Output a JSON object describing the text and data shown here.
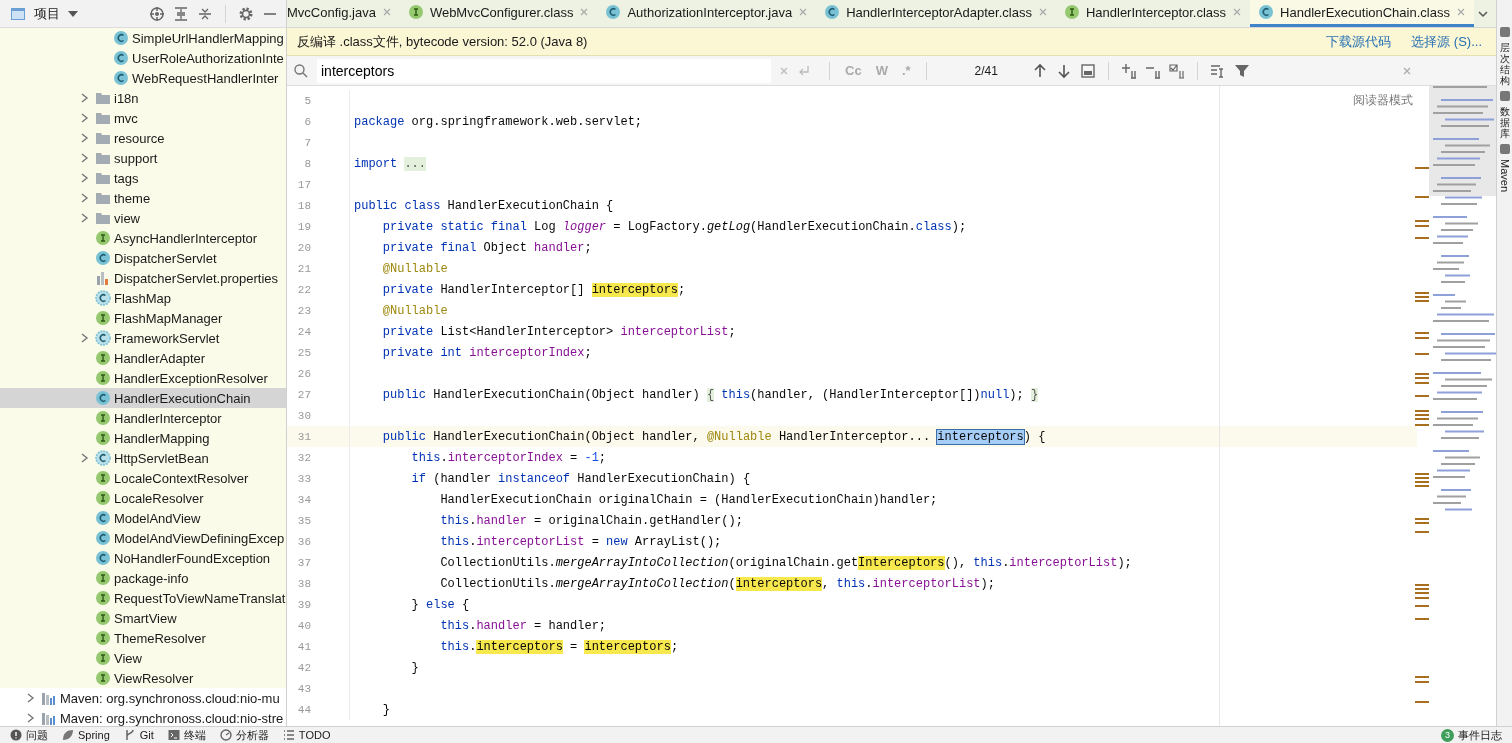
{
  "project_panel": {
    "title": "项目"
  },
  "tree": [
    {
      "children": [
        {
          "children": [
            {
              "children": [
                {
                  "children": [
                    {
                      "label": "SimpleUrlHandlerMapping",
                      "kind": "class",
                      "selected": false
                    },
                    {
                      "label": "UserRoleAuthorizationInte",
                      "kind": "class",
                      "selected": false
                    },
                    {
                      "label": "WebRequestHandlerInter",
                      "kind": "class",
                      "selected": false
                    }
                  ]
                },
                {
                  "label": "i18n",
                  "kind": "folder",
                  "expanded": false,
                  "selected": false
                },
                {
                  "label": "mvc",
                  "kind": "folder",
                  "expanded": false,
                  "selected": false
                },
                {
                  "label": "resource",
                  "kind": "folder",
                  "expanded": false,
                  "selected": false
                },
                {
                  "label": "support",
                  "kind": "folder",
                  "expanded": false,
                  "selected": false
                },
                {
                  "label": "tags",
                  "kind": "folder",
                  "expanded": false,
                  "selected": false
                },
                {
                  "label": "theme",
                  "kind": "folder",
                  "expanded": false,
                  "selected": false
                },
                {
                  "label": "view",
                  "kind": "folder",
                  "expanded": false,
                  "selected": false
                },
                {
                  "label": "AsyncHandlerInterceptor",
                  "kind": "interface",
                  "selected": false
                },
                {
                  "label": "DispatcherServlet",
                  "kind": "class",
                  "selected": false
                },
                {
                  "label": "DispatcherServlet.properties",
                  "kind": "properties",
                  "selected": false
                },
                {
                  "label": "FlashMap",
                  "kind": "abstract",
                  "selected": false
                },
                {
                  "label": "FlashMapManager",
                  "kind": "interface",
                  "selected": false
                },
                {
                  "label": "FrameworkServlet",
                  "kind": "abstract",
                  "expanded": false,
                  "selected": false
                },
                {
                  "label": "HandlerAdapter",
                  "kind": "interface",
                  "selected": false
                },
                {
                  "label": "HandlerExceptionResolver",
                  "kind": "interface",
                  "selected": false
                },
                {
                  "label": "HandlerExecutionChain",
                  "kind": "class",
                  "selected": true
                },
                {
                  "label": "HandlerInterceptor",
                  "kind": "interface",
                  "selected": false
                },
                {
                  "label": "HandlerMapping",
                  "kind": "interface",
                  "selected": false
                },
                {
                  "label": "HttpServletBean",
                  "kind": "abstract",
                  "expanded": false,
                  "selected": false
                },
                {
                  "label": "LocaleContextResolver",
                  "kind": "interface",
                  "selected": false
                },
                {
                  "label": "LocaleResolver",
                  "kind": "interface",
                  "selected": false
                },
                {
                  "label": "ModelAndView",
                  "kind": "class",
                  "selected": false
                },
                {
                  "label": "ModelAndViewDefiningExcep",
                  "kind": "class",
                  "selected": false
                },
                {
                  "label": "NoHandlerFoundException",
                  "kind": "class",
                  "selected": false
                },
                {
                  "label": "package-info",
                  "kind": "interface",
                  "selected": false
                },
                {
                  "label": "RequestToViewNameTranslat",
                  "kind": "interface",
                  "selected": false
                },
                {
                  "label": "SmartView",
                  "kind": "interface",
                  "selected": false
                },
                {
                  "label": "ThemeResolver",
                  "kind": "interface",
                  "selected": false
                },
                {
                  "label": "View",
                  "kind": "interface",
                  "selected": false
                },
                {
                  "label": "ViewResolver",
                  "kind": "interface",
                  "selected": false
                }
              ]
            }
          ]
        }
      ]
    },
    {
      "label": "Maven: org.synchronoss.cloud:nio-mu",
      "kind": "library",
      "expanded": false,
      "selected": false
    },
    {
      "label": "Maven: org.synchronoss.cloud:nio-stre",
      "kind": "library",
      "expanded": false,
      "selected": false
    }
  ],
  "tabs": [
    {
      "label": "MvcConfig.java",
      "selected": false
    },
    {
      "label": "WebMvcConfigurer.class",
      "kind": "interface",
      "selected": false
    },
    {
      "label": "AuthorizationInterceptor.java",
      "kind": "class",
      "selected": false
    },
    {
      "label": "HandlerInterceptorAdapter.class",
      "kind": "class",
      "selected": false
    },
    {
      "label": "HandlerInterceptor.class",
      "kind": "interface",
      "selected": false
    },
    {
      "label": "HandlerExecutionChain.class",
      "kind": "class",
      "selected": true
    }
  ],
  "info_bar": {
    "message": "反编译 .class文件, bytecode version: 52.0 (Java 8)",
    "links": [
      "下载源代码",
      "选择源 (S)..."
    ]
  },
  "find_bar": {
    "value": "interceptors",
    "options": [
      "Cc",
      "W",
      ".*"
    ],
    "match_count": "2/41"
  },
  "reader_mode": "阅读器模式",
  "code": [
    {
      "no": "5",
      "current": false
    },
    {
      "no": "6",
      "current": false,
      "segments": [
        {
          "kind": "k",
          "text": "package"
        },
        {
          "kind": "t",
          "text": " org.springframework.web.servlet;"
        }
      ]
    },
    {
      "no": "7",
      "current": false
    },
    {
      "no": "8",
      "current": false,
      "segments": [
        {
          "kind": "k",
          "text": "import "
        },
        {
          "kind": "fold",
          "text": "..."
        }
      ]
    },
    {
      "no": "17",
      "current": false
    },
    {
      "no": "18",
      "current": false,
      "segments": [
        {
          "kind": "k",
          "text": "public class"
        },
        {
          "kind": "t",
          "text": " HandlerExecutionChain {"
        }
      ]
    },
    {
      "no": "19",
      "current": false,
      "segments": [
        {
          "kind": "k",
          "text": "    private static final"
        },
        {
          "kind": "t",
          "text": " Log "
        },
        {
          "kind": "fi",
          "text": "logger"
        },
        {
          "kind": "t",
          "text": " = LogFactory."
        },
        {
          "kind": "i",
          "text": "getLog"
        },
        {
          "kind": "t",
          "text": "(HandlerExecutionChain."
        },
        {
          "kind": "k",
          "text": "class"
        },
        {
          "kind": "t",
          "text": ");"
        }
      ]
    },
    {
      "no": "20",
      "current": false,
      "segments": [
        {
          "kind": "k",
          "text": "    private final"
        },
        {
          "kind": "t",
          "text": " Object "
        },
        {
          "kind": "f",
          "text": "handler"
        },
        {
          "kind": "t",
          "text": ";"
        }
      ]
    },
    {
      "no": "21",
      "current": false,
      "segments": [
        {
          "kind": "a",
          "text": "    @Nullable"
        }
      ]
    },
    {
      "no": "22",
      "current": false,
      "segments": [
        {
          "kind": "k",
          "text": "    private"
        },
        {
          "kind": "t",
          "text": " HandlerInterceptor[] "
        },
        {
          "kind": "m",
          "text": "interceptors"
        },
        {
          "kind": "t",
          "text": ";"
        }
      ]
    },
    {
      "no": "23",
      "current": false,
      "segments": [
        {
          "kind": "a",
          "text": "    @Nullable"
        }
      ]
    },
    {
      "no": "24",
      "current": false,
      "segments": [
        {
          "kind": "k",
          "text": "    private"
        },
        {
          "kind": "t",
          "text": " List<HandlerInterceptor> "
        },
        {
          "kind": "f",
          "text": "interceptorList"
        },
        {
          "kind": "t",
          "text": ";"
        }
      ]
    },
    {
      "no": "25",
      "current": false,
      "segments": [
        {
          "kind": "k",
          "text": "    private int "
        },
        {
          "kind": "f",
          "text": "interceptorIndex"
        },
        {
          "kind": "t",
          "text": ";"
        }
      ]
    },
    {
      "no": "26",
      "current": false
    },
    {
      "no": "27",
      "current": false,
      "segments": [
        {
          "kind": "k",
          "text": "    public"
        },
        {
          "kind": "t",
          "text": " HandlerExecutionChain(Object handler) "
        },
        {
          "kind": "fold",
          "text": "{"
        },
        {
          "kind": "k",
          "text": " this"
        },
        {
          "kind": "t",
          "text": "(handler, (HandlerInterceptor[])"
        },
        {
          "kind": "k",
          "text": "null"
        },
        {
          "kind": "t",
          "text": "); "
        },
        {
          "kind": "fold",
          "text": "}"
        }
      ]
    },
    {
      "no": "30",
      "current": false
    },
    {
      "no": "31",
      "current": true,
      "segments": [
        {
          "kind": "k",
          "text": "    public"
        },
        {
          "kind": "t",
          "text": " HandlerExecutionChain(Object handler, "
        },
        {
          "kind": "a",
          "text": "@Nullable"
        },
        {
          "kind": "t",
          "text": " HandlerInterceptor... "
        },
        {
          "kind": "c",
          "text": "interceptors"
        },
        {
          "kind": "t",
          "text": ") {"
        }
      ]
    },
    {
      "no": "32",
      "current": false,
      "segments": [
        {
          "kind": "k",
          "text": "        this"
        },
        {
          "kind": "t",
          "text": "."
        },
        {
          "kind": "f",
          "text": "interceptorIndex"
        },
        {
          "kind": "t",
          "text": " = "
        },
        {
          "kind": "n",
          "text": "-1"
        },
        {
          "kind": "t",
          "text": ";"
        }
      ]
    },
    {
      "no": "33",
      "current": false,
      "segments": [
        {
          "kind": "k",
          "text": "        if"
        },
        {
          "kind": "t",
          "text": " (handler "
        },
        {
          "kind": "k",
          "text": "instanceof"
        },
        {
          "kind": "t",
          "text": " HandlerExecutionChain) {"
        }
      ]
    },
    {
      "no": "34",
      "current": false,
      "segments": [
        {
          "kind": "t",
          "text": "            HandlerExecutionChain originalChain = (HandlerExecutionChain)handler;"
        }
      ]
    },
    {
      "no": "35",
      "current": false,
      "segments": [
        {
          "kind": "k",
          "text": "            this"
        },
        {
          "kind": "t",
          "text": "."
        },
        {
          "kind": "f",
          "text": "handler"
        },
        {
          "kind": "t",
          "text": " = originalChain.getHandler();"
        }
      ]
    },
    {
      "no": "36",
      "current": false,
      "segments": [
        {
          "kind": "k",
          "text": "            this"
        },
        {
          "kind": "t",
          "text": "."
        },
        {
          "kind": "f",
          "text": "interceptorList"
        },
        {
          "kind": "t",
          "text": " = "
        },
        {
          "kind": "k",
          "text": "new"
        },
        {
          "kind": "t",
          "text": " ArrayList();"
        }
      ]
    },
    {
      "no": "37",
      "current": false,
      "segments": [
        {
          "kind": "t",
          "text": "            CollectionUtils."
        },
        {
          "kind": "i",
          "text": "mergeArrayIntoCollection"
        },
        {
          "kind": "t",
          "text": "(originalChain.get"
        },
        {
          "kind": "m",
          "text": "Interceptors"
        },
        {
          "kind": "t",
          "text": "(), "
        },
        {
          "kind": "k",
          "text": "this"
        },
        {
          "kind": "t",
          "text": "."
        },
        {
          "kind": "f",
          "text": "interceptorList"
        },
        {
          "kind": "t",
          "text": ");"
        }
      ]
    },
    {
      "no": "38",
      "current": false,
      "segments": [
        {
          "kind": "t",
          "text": "            CollectionUtils."
        },
        {
          "kind": "i",
          "text": "mergeArrayIntoCollection"
        },
        {
          "kind": "t",
          "text": "("
        },
        {
          "kind": "m",
          "text": "interceptors"
        },
        {
          "kind": "t",
          "text": ", "
        },
        {
          "kind": "k",
          "text": "this"
        },
        {
          "kind": "t",
          "text": "."
        },
        {
          "kind": "f",
          "text": "interceptorList"
        },
        {
          "kind": "t",
          "text": ");"
        }
      ]
    },
    {
      "no": "39",
      "current": false,
      "segments": [
        {
          "kind": "t",
          "text": "        } "
        },
        {
          "kind": "k",
          "text": "else"
        },
        {
          "kind": "t",
          "text": " {"
        }
      ]
    },
    {
      "no": "40",
      "current": false,
      "segments": [
        {
          "kind": "k",
          "text": "            this"
        },
        {
          "kind": "t",
          "text": "."
        },
        {
          "kind": "f",
          "text": "handler"
        },
        {
          "kind": "t",
          "text": " = handler;"
        }
      ]
    },
    {
      "no": "41",
      "current": false,
      "segments": [
        {
          "kind": "k",
          "text": "            this"
        },
        {
          "kind": "t",
          "text": "."
        },
        {
          "kind": "m",
          "text": "interceptors"
        },
        {
          "kind": "t",
          "text": " = "
        },
        {
          "kind": "m",
          "text": "interceptors"
        },
        {
          "kind": "t",
          "text": ";"
        }
      ]
    },
    {
      "no": "42",
      "current": false,
      "segments": [
        {
          "kind": "t",
          "text": "        }"
        }
      ]
    },
    {
      "no": "43",
      "current": false
    },
    {
      "no": "44",
      "current": false,
      "segments": [
        {
          "kind": "t",
          "text": "    }"
        }
      ]
    }
  ],
  "tool_windows": [
    {
      "label": "层次结构",
      "kind": "cjk"
    },
    {
      "label": "数据库",
      "kind": "cjk"
    },
    {
      "label": "Maven",
      "kind": "latin"
    }
  ],
  "bottom_tools": [
    {
      "label": "问题",
      "kind": "alert"
    },
    {
      "label": "Spring",
      "kind": "leaf"
    },
    {
      "label": "Git",
      "kind": "branch"
    },
    {
      "label": "终端",
      "kind": "terminal"
    },
    {
      "label": "分析器",
      "kind": "gauge"
    },
    {
      "label": "TODO",
      "kind": "list"
    }
  ],
  "event_log": {
    "count": "3",
    "label": "事件日志"
  }
}
